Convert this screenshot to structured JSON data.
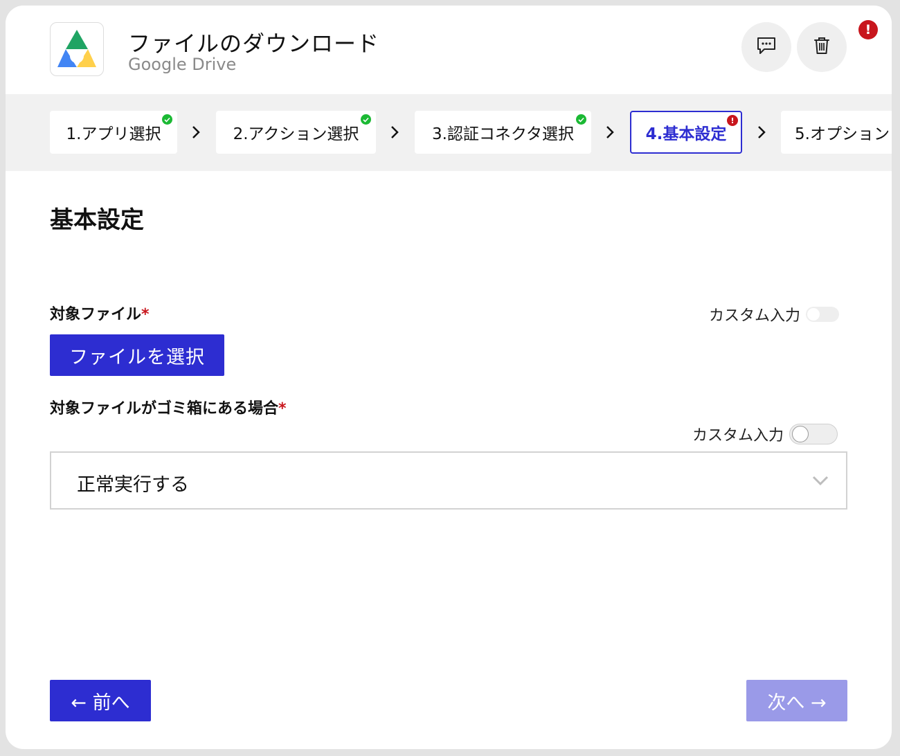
{
  "header": {
    "action_title": "ファイルのダウンロード",
    "app_name": "Google Drive",
    "icons": {
      "comment": "comment-icon",
      "trash": "trash-icon",
      "error": "error-icon"
    },
    "error_badge": "!"
  },
  "stepper": {
    "steps": [
      {
        "label": "1.アプリ選択",
        "status": "done"
      },
      {
        "label": "2.アクション選択",
        "status": "done"
      },
      {
        "label": "3.認証コネクタ選択",
        "status": "done"
      },
      {
        "label": "4.基本設定",
        "status": "error",
        "active": true
      },
      {
        "label": "5.オプション",
        "status": "none"
      }
    ],
    "error_mark": "!"
  },
  "content": {
    "section_title": "基本設定",
    "field1": {
      "label": "対象ファイル",
      "required_mark": "*",
      "custom_input_label": "カスタム入力",
      "custom_input_on": false,
      "button_label": "ファイルを選択"
    },
    "field2": {
      "label": "対象ファイルがゴミ箱にある場合",
      "required_mark": "*",
      "custom_input_label": "カスタム入力",
      "custom_input_on": false,
      "selected_value": "正常実行する"
    }
  },
  "footer": {
    "prev_label": "← 前へ",
    "next_label": "次へ →"
  },
  "colors": {
    "primary": "#2d2dd1",
    "primary_disabled": "#9a9ae8",
    "success": "#1bb934",
    "error": "#c8161d"
  }
}
